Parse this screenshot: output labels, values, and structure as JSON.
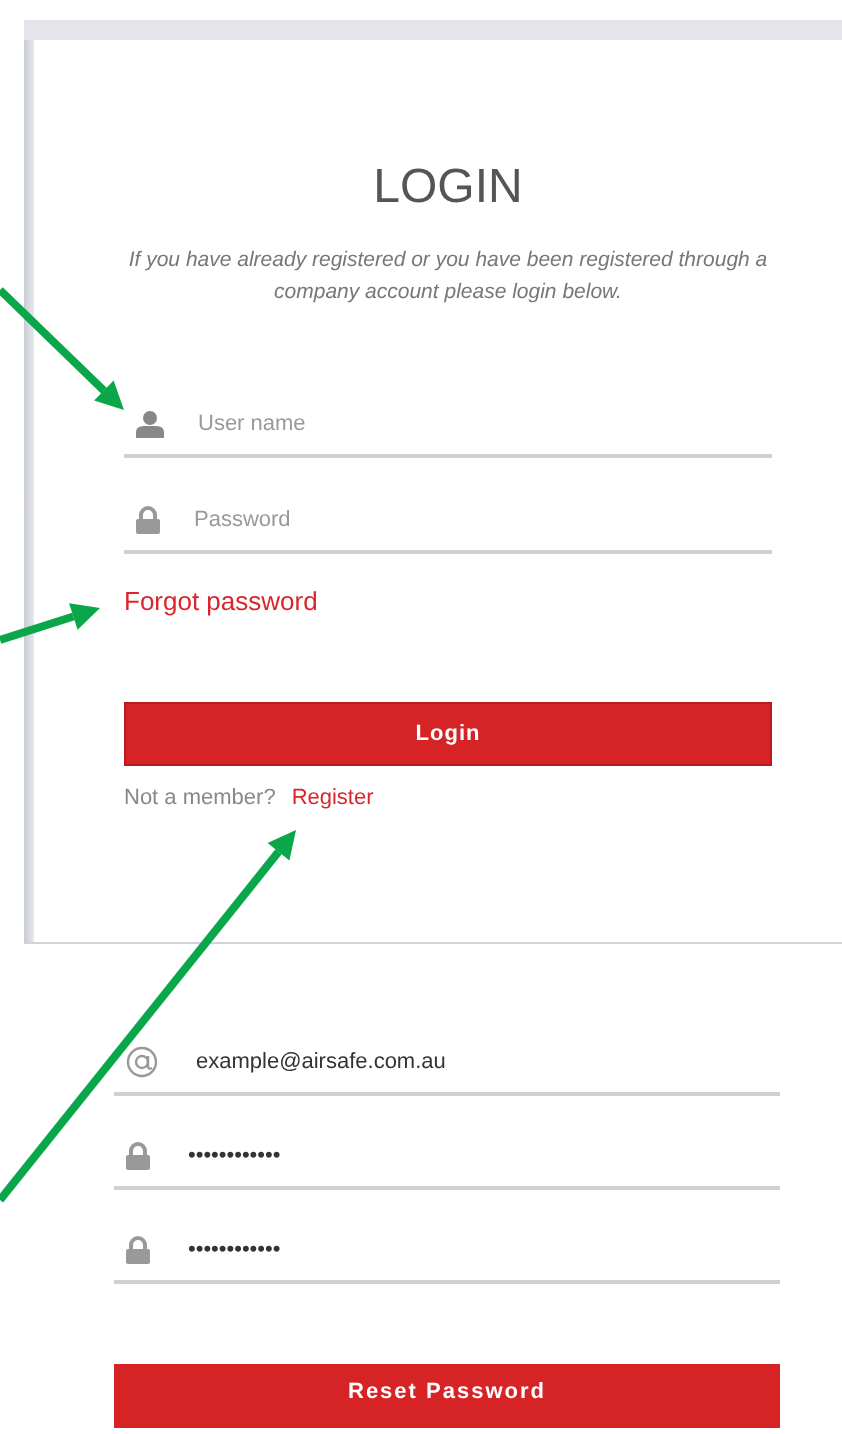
{
  "login": {
    "title": "LOGIN",
    "subtitle": "If you have already registered or you have been registered through a company account please login below.",
    "fields": [
      {
        "kind": "user",
        "placeholder": "User name"
      },
      {
        "kind": "lock",
        "placeholder": "Password"
      }
    ],
    "forgot_link": "Forgot password",
    "button": "Login",
    "register_prompt": "Not a member?",
    "register_link": "Register"
  },
  "reset": {
    "fields": [
      {
        "kind": "at",
        "value": "example@airsafe.com.au"
      },
      {
        "kind": "lock",
        "value": "••••••••••••"
      },
      {
        "kind": "lock",
        "value": "••••••••••••"
      }
    ],
    "button": "Reset Password"
  },
  "annotations": [
    {
      "kind": "arrow"
    },
    {
      "kind": "arrow"
    },
    {
      "kind": "arrow"
    }
  ]
}
